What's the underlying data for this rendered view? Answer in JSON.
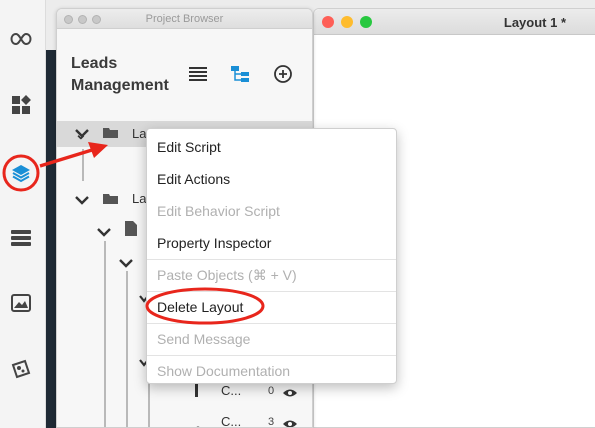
{
  "rail": {
    "items": [
      {
        "icon": "infinity-icon"
      },
      {
        "icon": "widgets-icon"
      },
      {
        "icon": "layers-icon",
        "active": true
      },
      {
        "icon": "database-icon"
      },
      {
        "icon": "image-icon"
      },
      {
        "icon": "palette-icon"
      }
    ]
  },
  "project_browser": {
    "window_title": "Project Browser",
    "project_name": "Leads Management",
    "tree": {
      "row1_label": "Lay",
      "row2_label": "La",
      "counts": [
        "0",
        "3"
      ],
      "leaf_labels": [
        "C...",
        "C..."
      ]
    }
  },
  "layout_window": {
    "title": "Layout 1 *"
  },
  "context_menu": {
    "items": [
      {
        "label": "Edit Script",
        "enabled": true
      },
      {
        "label": "Edit Actions",
        "enabled": true
      },
      {
        "label": "Edit Behavior Script",
        "enabled": false
      },
      {
        "label": "Property Inspector",
        "enabled": true
      },
      {
        "label": "Paste Objects (⌘ + V)",
        "enabled": false
      },
      {
        "label": "Delete Layout",
        "enabled": true,
        "highlighted": true
      },
      {
        "label": "Send Message",
        "enabled": false
      },
      {
        "label": "Show Documentation",
        "enabled": false
      }
    ]
  },
  "colors": {
    "accent_blue": "#1a8fd6",
    "annotation_red": "#e8261c",
    "mac_red": "#fe5f57",
    "mac_yellow": "#febc2e",
    "mac_green": "#28c840"
  }
}
